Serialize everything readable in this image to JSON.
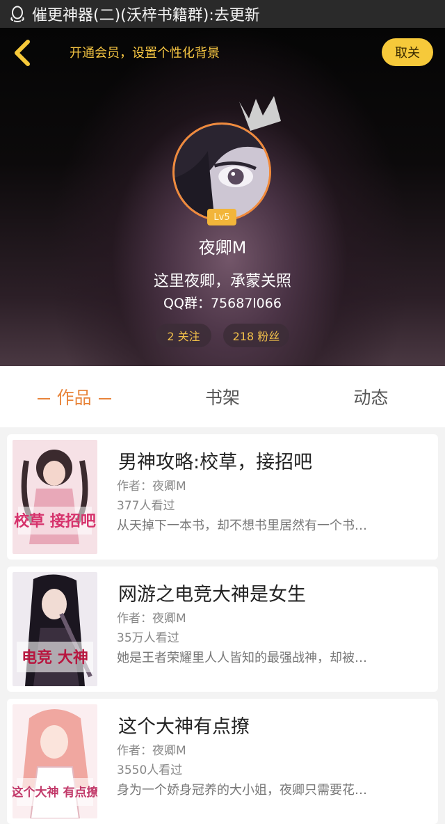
{
  "status_bar": {
    "text": "催更神器(二)(沃梓书籍群):去更新"
  },
  "header": {
    "vip_text": "开通会员，设置个性化背景",
    "unfollow_label": "取关",
    "level": "Lv5",
    "username": "夜卿M",
    "bio": "这里夜卿，承蒙关照",
    "qq_group": "QQ群：75687l066",
    "following": "2 关注",
    "fans": "218 粉丝",
    "accent_color": "#f6c93a"
  },
  "tabs": [
    {
      "label": "作品",
      "dash": "—",
      "active": true
    },
    {
      "label": "书架",
      "active": false
    },
    {
      "label": "动态",
      "active": false
    }
  ],
  "books": [
    {
      "title": "男神攻略:校草，接招吧",
      "author": "作者：夜卿M",
      "views": "377人看过",
      "desc": "从天掉下一本书，却不想书里居然有一个书…",
      "cover_text": "校草 接招吧"
    },
    {
      "title": "网游之电竞大神是女生",
      "author": "作者：夜卿M",
      "views": "35万人看过",
      "desc": "她是王者荣耀里人人皆知的最强战神，却被…",
      "cover_text": "电竞 大神"
    },
    {
      "title": "这个大神有点撩",
      "author": "作者：夜卿M",
      "views": "3550人看过",
      "desc": "身为一个娇身冠养的大小姐，夜卿只需要花…",
      "cover_text": "这个大神 有点撩"
    }
  ]
}
